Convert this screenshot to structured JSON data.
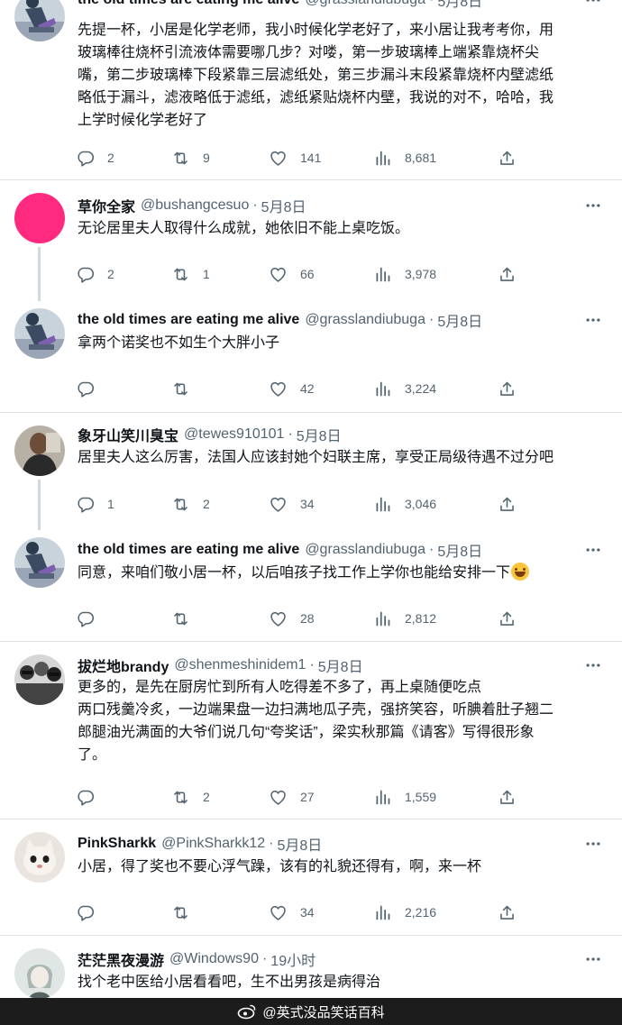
{
  "tweets": [
    {
      "name": "the old times are eating me alive",
      "handle": "@grasslandiubuga",
      "time": "5月8日",
      "text": "先提一杯，小居是化学老师，我小时候化学老好了，来小居让我考考你，用\n玻璃棒往烧杯引流液体需要哪几步？对喽，第一步玻璃棒上端紧靠烧杯尖\n嘴，第二步玻璃棒下段紧靠三层滤纸处，第三步漏斗末段紧靠烧杯内壁滤纸\n略低于漏斗，滤液略低于滤纸，滤纸紧贴烧杯内壁，我说的对不，哈哈，我\n上学时候化学老好了",
      "replies": "2",
      "retweets": "9",
      "likes": "141",
      "views": "8,681"
    },
    {
      "name": "草你全家",
      "handle": "@bushangcesuo",
      "time": "5月8日",
      "text": "无论居里夫人取得什么成就，她依旧不能上桌吃饭。",
      "replies": "2",
      "retweets": "1",
      "likes": "66",
      "views": "3,978"
    },
    {
      "name": "the old times are eating me alive",
      "handle": "@grasslandiubuga",
      "time": "5月8日",
      "text": "拿两个诺奖也不如生个大胖小子",
      "replies": "",
      "retweets": "",
      "likes": "42",
      "views": "3,224"
    },
    {
      "name": "象牙山笑川臭宝",
      "handle": "@tewes910101",
      "time": "5月8日",
      "text": "居里夫人这么厉害，法国人应该封她个妇联主席，享受正局级待遇不过分吧",
      "replies": "1",
      "retweets": "2",
      "likes": "34",
      "views": "3,046"
    },
    {
      "name": "the old times are eating me alive",
      "handle": "@grasslandiubuga",
      "time": "5月8日",
      "text": "同意，来咱们敬小居一杯，以后咱孩子找工作上学你也能给安排一下",
      "replies": "",
      "retweets": "",
      "likes": "28",
      "views": "2,812"
    },
    {
      "name": "拔烂地brandy",
      "handle": "@shenmeshinidem1",
      "time": "5月8日",
      "text": "更多的，是先在厨房忙到所有人吃得差不多了，再上桌随便吃点\n两口残羹冷炙，一边端果盘一边扫满地瓜子壳，强挤笑容，听腆着肚子翘二\n郎腿油光满面的大爷们说几句“夸奖话”，梁实秋那篇《请客》写得很形象\n了。",
      "replies": "",
      "retweets": "2",
      "likes": "27",
      "views": "1,559"
    },
    {
      "name": "PinkSharkk",
      "handle": "@PinkSharkk12",
      "time": "5月8日",
      "text": "小居，得了奖也不要心浮气躁，该有的礼貌还得有，啊，来一杯",
      "replies": "",
      "retweets": "",
      "likes": "34",
      "views": "2,216"
    },
    {
      "name": "茫茫黑夜漫游",
      "handle": "@Windows90",
      "time": "19小时",
      "text": "找个老中医给小居看看吧，生不出男孩是病得治",
      "replies": "",
      "retweets": "",
      "likes": "",
      "views": ""
    }
  ],
  "watermark": {
    "text": "@英式没品笑话百科",
    "logo": "weibo-logo-icon"
  },
  "icons": {
    "reply": "reply-icon",
    "retweet": "retweet-icon",
    "like": "like-icon",
    "views": "views-icon",
    "share": "share-icon",
    "more": "more-icon"
  },
  "colors": {
    "text": "#0f1419",
    "secondary": "#536471",
    "thread_line": "#cfd9de",
    "divider": "#dde2e6"
  }
}
